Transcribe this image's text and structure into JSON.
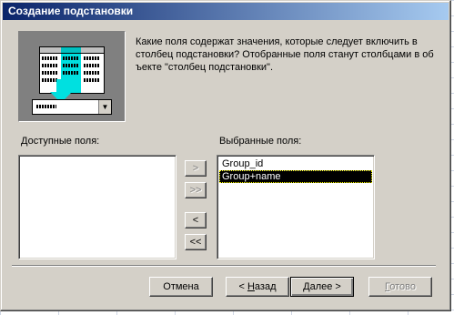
{
  "window": {
    "title": "Создание подстановки"
  },
  "description": "Какие поля содержат значения, которые следует включить в столбец подстановки? Отобранные поля станут столбцами в об ъекте \"столбец подстановки\".",
  "available": {
    "label": "Доступные поля:",
    "items": []
  },
  "selected": {
    "label": "Выбранные поля:",
    "items": [
      "Group_id",
      "Group+name"
    ],
    "selected_index": 1
  },
  "move_buttons": {
    "add_one": ">",
    "add_all": ">>",
    "remove_one": "<",
    "remove_all": "<<"
  },
  "footer": {
    "cancel": "Отмена",
    "back_prefix": "< ",
    "back_accel": "Н",
    "back_rest": "азад",
    "next_accel": "Д",
    "next_rest": "алее >",
    "finish_accel": "Г",
    "finish_rest": "отово"
  },
  "colors": {
    "dialog_bg": "#d4d0c8",
    "title_start": "#0a246a",
    "title_end": "#a6caf0",
    "selection": "#000000",
    "illustration_accent": "#00e0e0"
  }
}
